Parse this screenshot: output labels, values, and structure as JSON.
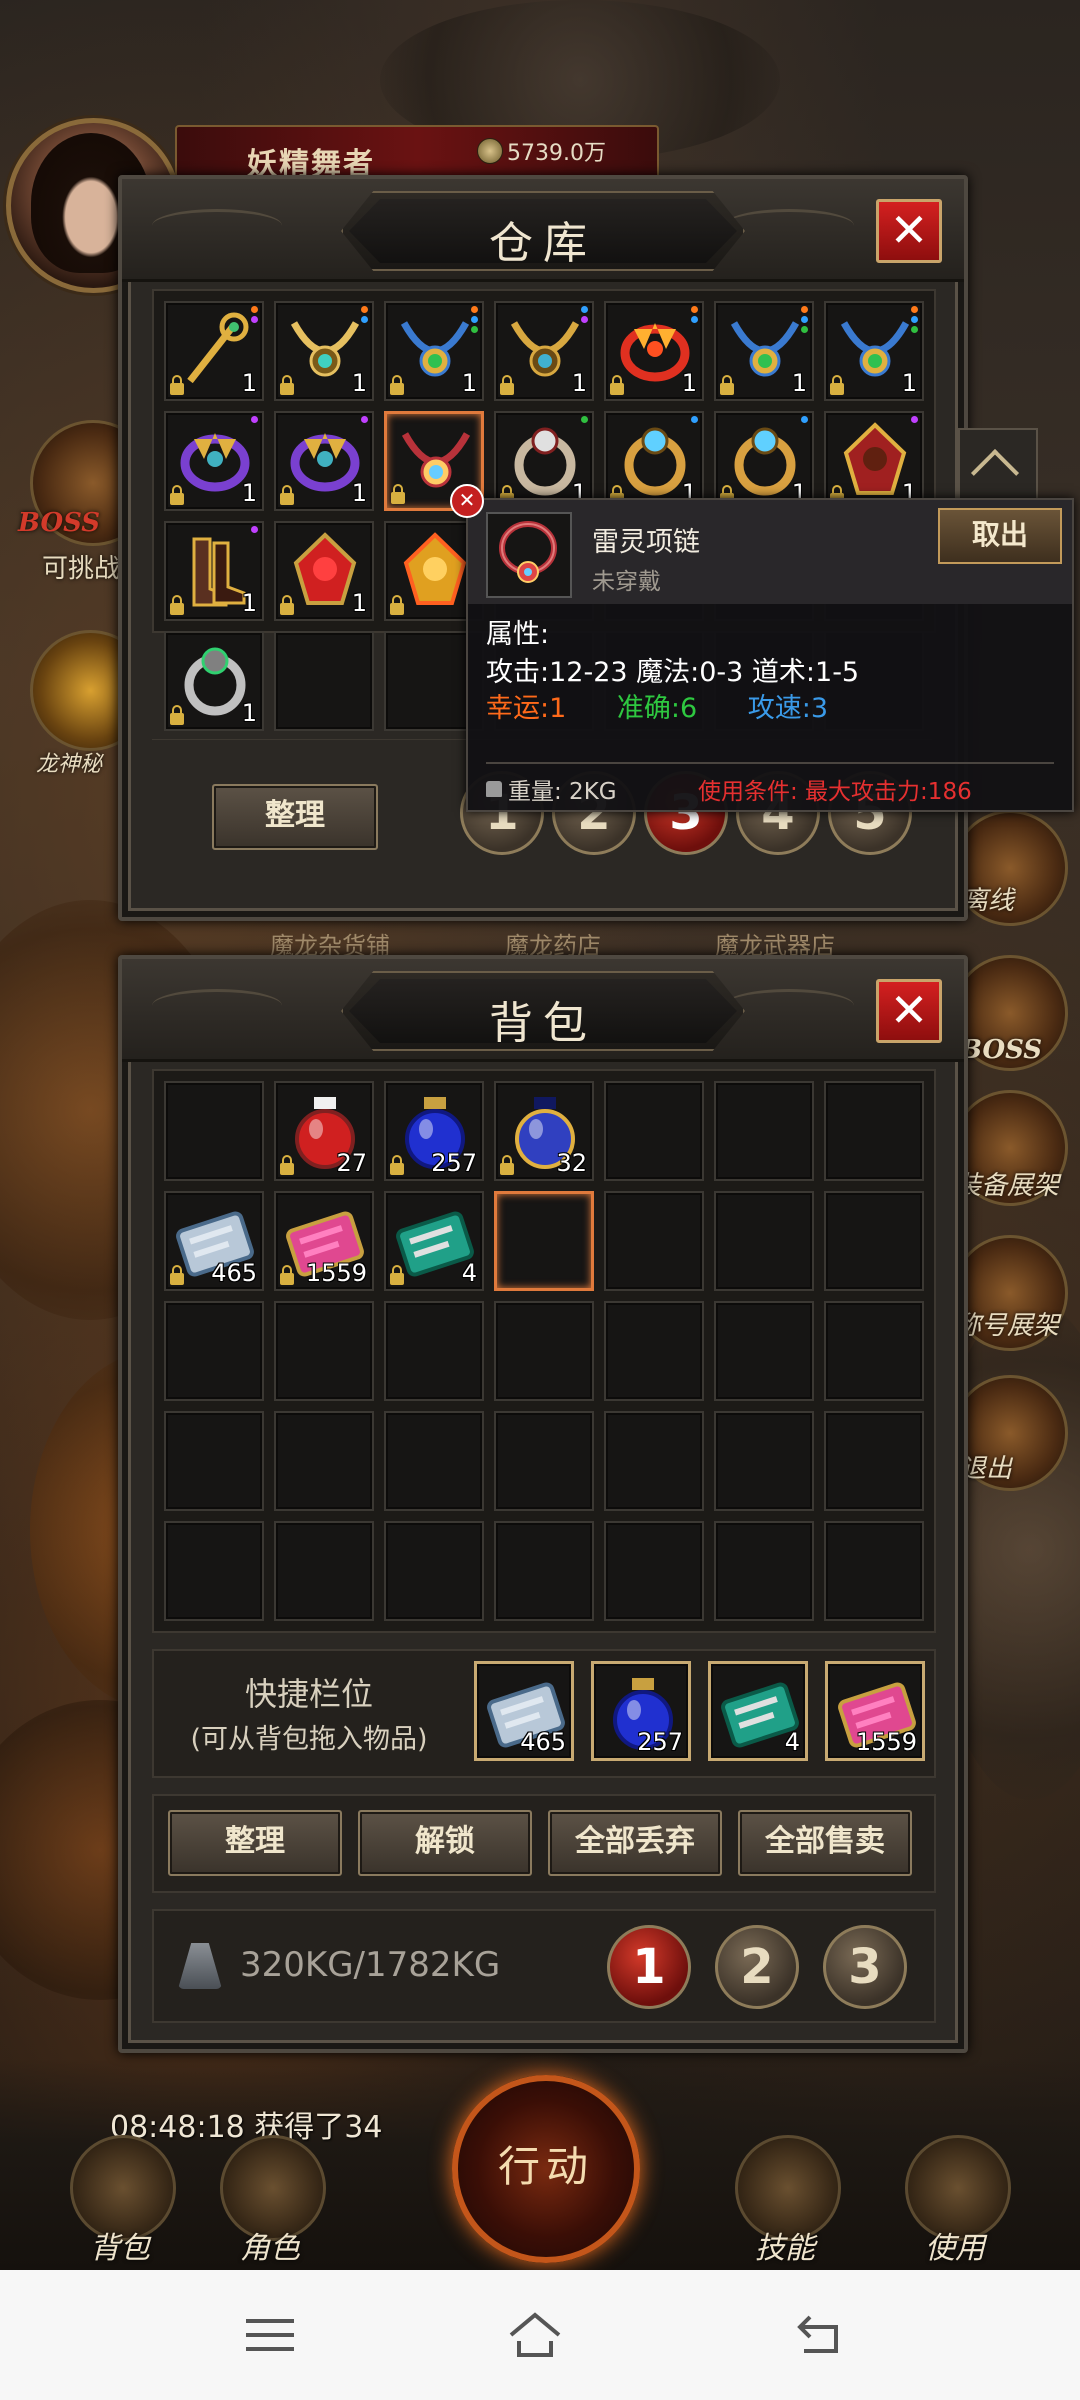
{
  "player": {
    "name": "妖精舞者",
    "gold": "5739.0万"
  },
  "side_menu_left": [
    {
      "label": "BOSS",
      "icon": "boss-emblem-icon"
    },
    {
      "label": "可挑战",
      "icon": ""
    },
    {
      "label": "龙神秘",
      "icon": "dragon-icon"
    }
  ],
  "side_menu_right": [
    {
      "label": "离线",
      "icon": "offline-icon"
    },
    {
      "label": "BOSS",
      "icon": "boss-helmet-icon"
    },
    {
      "label": "装备展架",
      "icon": "sword-icon"
    },
    {
      "label": "称号展架",
      "icon": "scroll-icon"
    },
    {
      "label": "退出",
      "icon": "exit-icon"
    }
  ],
  "shop_tabs": [
    "魔龙杂货铺",
    "魔龙药店",
    "魔龙武器店"
  ],
  "warehouse": {
    "title": "仓库",
    "close": "✕",
    "sort_label": "整理",
    "pages": [
      "1",
      "2",
      "3",
      "4",
      "5"
    ],
    "active_page": 3,
    "items": [
      {
        "slot": 0,
        "icon": "golden-staff-icon",
        "count": "1",
        "dots": [
          "#ff7a1a",
          "#c040ff"
        ]
      },
      {
        "slot": 1,
        "icon": "jade-amulet-icon",
        "count": "1",
        "dots": [
          "#ff7a1a",
          "#30a0ff"
        ]
      },
      {
        "slot": 2,
        "icon": "emerald-necklace-icon",
        "count": "1",
        "dots": [
          "#ff7a1a",
          "#30a0ff",
          "#30c040"
        ]
      },
      {
        "slot": 3,
        "icon": "golden-necklace-icon",
        "count": "1",
        "dots": [
          "#30a0ff",
          "#c040ff"
        ]
      },
      {
        "slot": 4,
        "icon": "flame-crown-icon",
        "count": "1",
        "dots": [
          "#ff7a1a",
          "#30a0ff"
        ]
      },
      {
        "slot": 5,
        "icon": "emerald-necklace-icon",
        "count": "1",
        "dots": [
          "#ff7a1a",
          "#30a0ff",
          "#30c040"
        ]
      },
      {
        "slot": 6,
        "icon": "emerald-necklace-icon",
        "count": "1",
        "dots": [
          "#ff7a1a",
          "#30a0ff",
          "#30c040"
        ]
      },
      {
        "slot": 7,
        "icon": "purple-bracelet-icon",
        "count": "1",
        "dots": [
          "#c040ff"
        ]
      },
      {
        "slot": 8,
        "icon": "purple-bracelet-icon",
        "count": "1",
        "dots": [
          "#c040ff"
        ]
      },
      {
        "slot": 9,
        "icon": "thunder-necklace-icon",
        "count": "",
        "dots": [],
        "selected": true
      },
      {
        "slot": 10,
        "icon": "skull-ring-icon",
        "count": "1",
        "dots": [
          "#30c040"
        ]
      },
      {
        "slot": 11,
        "icon": "crystal-ring-icon",
        "count": "1",
        "dots": [
          "#30a0ff"
        ]
      },
      {
        "slot": 12,
        "icon": "crystal-ring-icon",
        "count": "1",
        "dots": [
          "#30a0ff"
        ]
      },
      {
        "slot": 13,
        "icon": "dragon-bracer-icon",
        "count": "1",
        "dots": [
          "#c040ff"
        ]
      },
      {
        "slot": 14,
        "icon": "boots-icon",
        "count": "1",
        "dots": [
          "#c040ff"
        ]
      },
      {
        "slot": 15,
        "icon": "ruby-belt-icon",
        "count": "1",
        "dots": []
      },
      {
        "slot": 16,
        "icon": "sun-helmet-icon",
        "count": "",
        "dots": []
      },
      {
        "slot": 21,
        "icon": "jade-ring-icon",
        "count": "1",
        "dots": []
      }
    ]
  },
  "tooltip": {
    "name": "雷灵项链",
    "state": "未穿戴",
    "take_label": "取出",
    "attr_title": "属性:",
    "line1": "攻击:12-23  魔法:0-3  道术:1-5",
    "luck": "幸运:1",
    "accuracy": "准确:6",
    "speed": "攻速:3",
    "weight": "重量:  2KG",
    "condition": "使用条件:  最大攻击力:186",
    "colors": {
      "luck": "#ff6a1a",
      "accuracy": "#2ec840",
      "speed": "#3a9ae8"
    }
  },
  "backpack": {
    "title": "背包",
    "close": "✕",
    "items": [
      {
        "slot": 1,
        "icon": "red-potion-icon",
        "count": "27"
      },
      {
        "slot": 2,
        "icon": "blue-potion-icon",
        "count": "257"
      },
      {
        "slot": 3,
        "icon": "sun-potion-icon",
        "count": "32"
      },
      {
        "slot": 7,
        "icon": "silver-scroll-icon",
        "count": "465"
      },
      {
        "slot": 8,
        "icon": "pink-scroll-icon",
        "count": "1559"
      },
      {
        "slot": 9,
        "icon": "green-book-icon",
        "count": "4"
      },
      {
        "slot": 10,
        "icon": "",
        "count": "",
        "selected": true
      }
    ],
    "quick_bar_title": "快捷栏位",
    "quick_bar_hint": "(可从背包拖入物品)",
    "quick_slots": [
      {
        "icon": "silver-scroll-icon",
        "count": "465"
      },
      {
        "icon": "blue-potion-icon",
        "count": "257"
      },
      {
        "icon": "green-book-icon",
        "count": "4"
      },
      {
        "icon": "pink-scroll-icon",
        "count": "1559"
      }
    ],
    "buttons": [
      "整理",
      "解锁",
      "全部丢弃",
      "全部售卖"
    ],
    "weight": "320KG/1782KG",
    "pages": [
      "1",
      "2",
      "3"
    ],
    "active_page": 1
  },
  "bottom_bar": {
    "log": "08:48:18  获得了34",
    "action": "行动",
    "buttons": [
      {
        "label": "背包",
        "icon": "bag-icon"
      },
      {
        "label": "角色",
        "icon": "helmet-icon"
      },
      {
        "label": "技能",
        "icon": "skill-book-icon"
      },
      {
        "label": "使用",
        "icon": "use-hand-icon"
      }
    ]
  },
  "nav": {
    "menu": "menu-icon",
    "home": "home-icon",
    "back": "back-icon"
  }
}
